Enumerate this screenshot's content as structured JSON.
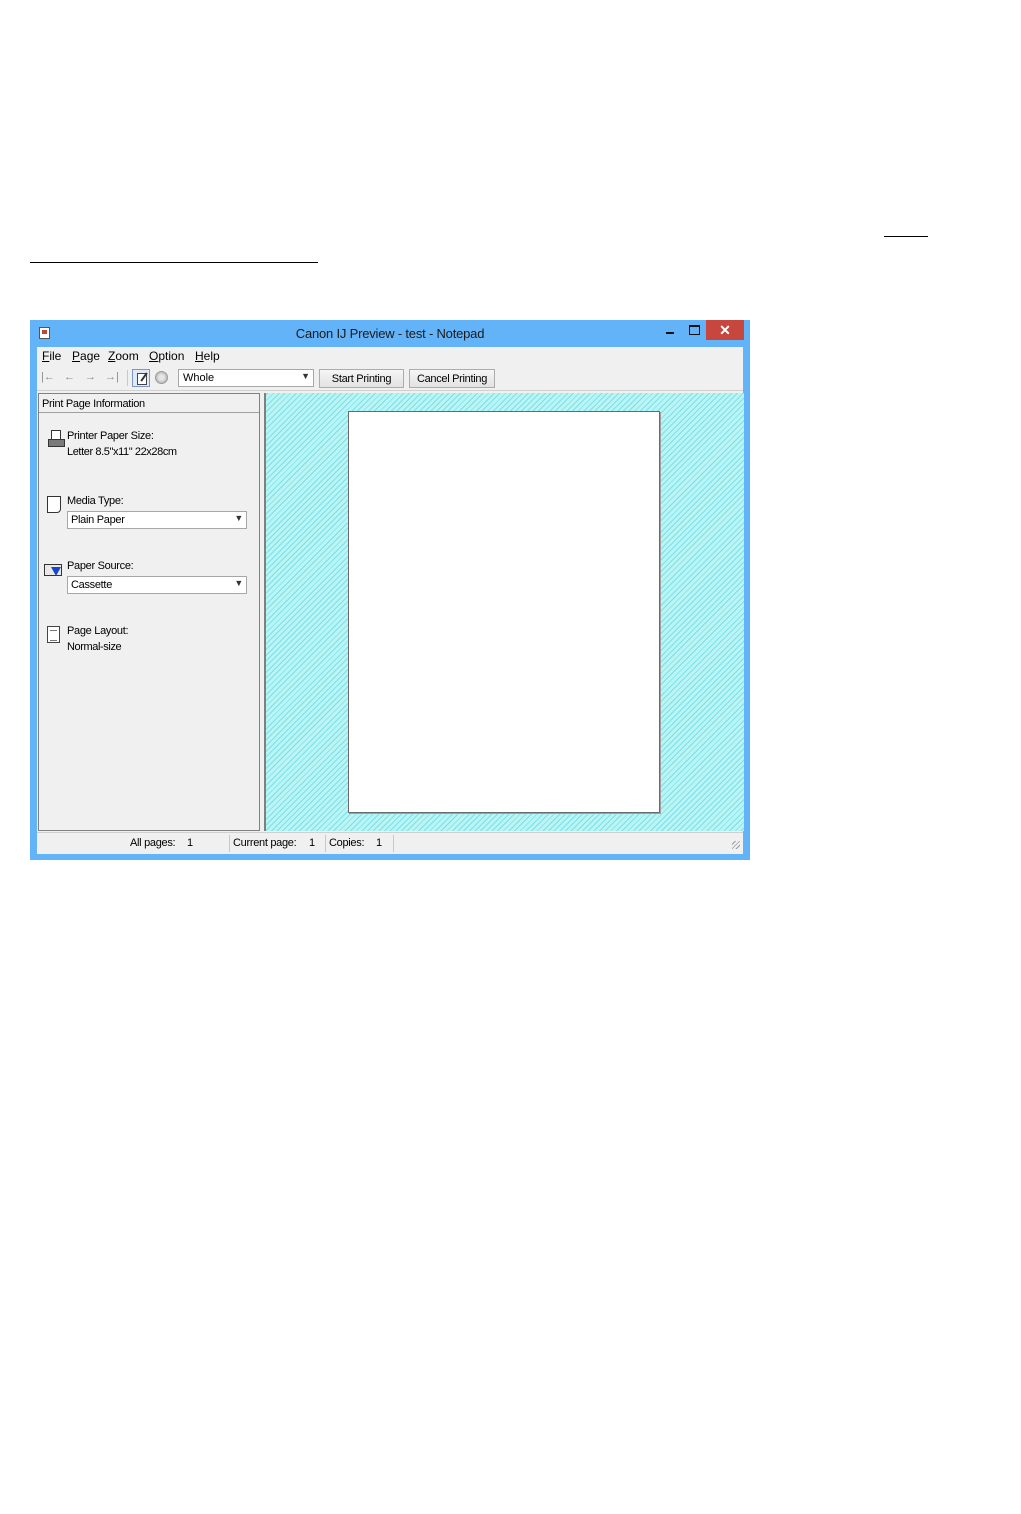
{
  "window": {
    "title": "Canon IJ Preview - test - Notepad"
  },
  "window_controls": {
    "minimize": "",
    "maximize": "",
    "close": "✕"
  },
  "menubar": {
    "items": [
      "File",
      "Page",
      "Zoom",
      "Option",
      "Help"
    ]
  },
  "toolbar": {
    "nav": [
      "|←",
      "←",
      "→",
      "→|"
    ],
    "zoom_value": "Whole",
    "start_label": "Start Printing",
    "cancel_label": "Cancel Printing"
  },
  "panel": {
    "header": "Print Page Information",
    "paper_size_label": "Printer Paper Size:",
    "paper_size_value": "Letter 8.5\"x11\" 22x28cm",
    "media_type_label": "Media Type:",
    "media_type_value": "Plain Paper",
    "paper_source_label": "Paper Source:",
    "paper_source_value": "Cassette",
    "page_layout_label": "Page Layout:",
    "page_layout_value": "Normal-size"
  },
  "status": {
    "all_pages_label": "All pages:",
    "all_pages_value": "1",
    "current_page_label": "Current page:",
    "current_page_value": "1",
    "copies_label": "Copies:",
    "copies_value": "1"
  },
  "icons": {
    "app": "app-icon",
    "pencil": "edit-page-icon",
    "globe": "globe-icon",
    "printer": "printer-paper-icon",
    "media": "media-type-icon",
    "source": "paper-source-icon",
    "layout": "page-layout-icon"
  },
  "colors": {
    "titlebar": "#62b3f7",
    "close": "#c7463d",
    "preview_bg": "#aef1f1"
  }
}
